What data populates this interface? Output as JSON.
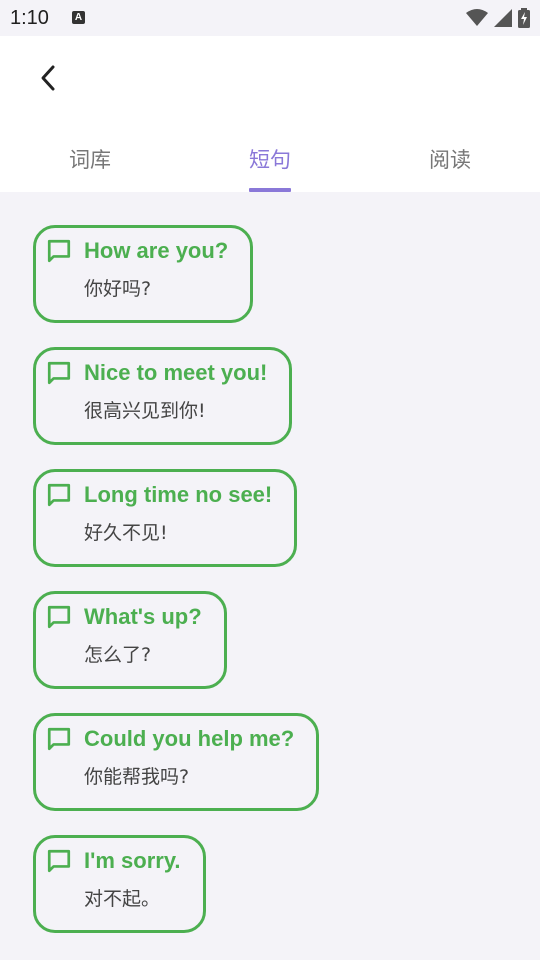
{
  "status_bar": {
    "time": "1:10",
    "icons": [
      "a-notification-icon",
      "wifi-icon",
      "signal-icon",
      "battery-charging-icon"
    ]
  },
  "appbar": {
    "back_icon": "chevron-left-icon"
  },
  "tabs": [
    {
      "label": "词库",
      "active": false
    },
    {
      "label": "短句",
      "active": true
    },
    {
      "label": "阅读",
      "active": false
    }
  ],
  "colors": {
    "accent": "#8a78d8",
    "card_border": "#4caf50",
    "phrase_text": "#4caf50",
    "background": "#f4f3f8"
  },
  "phrases": [
    {
      "en": "How are you?",
      "zh": "你好吗?"
    },
    {
      "en": "Nice to meet you!",
      "zh": "很高兴见到你!"
    },
    {
      "en": "Long time no see!",
      "zh": "好久不见!"
    },
    {
      "en": "What's up?",
      "zh": "怎么了?"
    },
    {
      "en": "Could you help me?",
      "zh": "你能帮我吗?"
    },
    {
      "en": "I'm sorry.",
      "zh": "对不起。"
    }
  ]
}
